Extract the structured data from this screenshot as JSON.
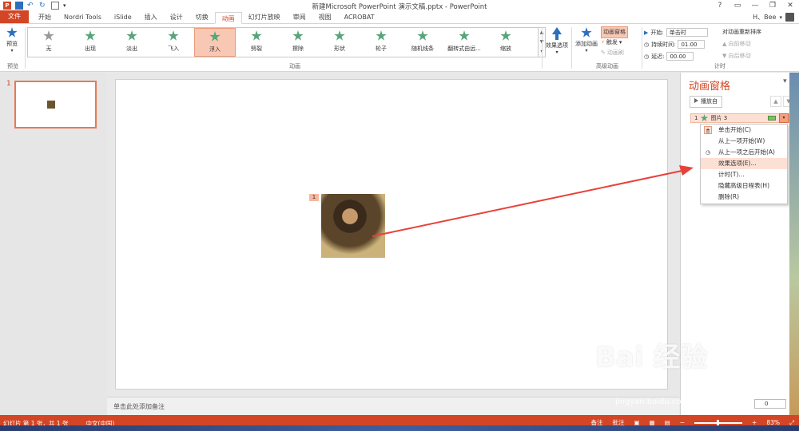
{
  "window": {
    "title": "新建Microsoft PowerPoint 演示文稿.pptx - PowerPoint",
    "controls": [
      "?",
      "▭",
      "—",
      "❐",
      "✕"
    ],
    "user": "H、Bee"
  },
  "tabs": [
    {
      "label": "文件"
    },
    {
      "label": "开始"
    },
    {
      "label": "Nordri Tools"
    },
    {
      "label": "iSlide"
    },
    {
      "label": "插入"
    },
    {
      "label": "设计"
    },
    {
      "label": "切换"
    },
    {
      "label": "动画"
    },
    {
      "label": "幻灯片放映"
    },
    {
      "label": "审阅"
    },
    {
      "label": "视图"
    },
    {
      "label": "ACROBAT"
    }
  ],
  "active_tab": "动画",
  "ribbon": {
    "preview_label": "预览",
    "preview_group": "预览",
    "animation_group": "动画",
    "animations": [
      {
        "label": "无",
        "icon": "star-icon"
      },
      {
        "label": "出现",
        "icon": "star-burst-icon"
      },
      {
        "label": "淡出",
        "icon": "star-icon"
      },
      {
        "label": "飞入",
        "icon": "star-icon"
      },
      {
        "label": "浮入",
        "icon": "star-icon"
      },
      {
        "label": "劈裂",
        "icon": "star-icon"
      },
      {
        "label": "擦除",
        "icon": "star-icon"
      },
      {
        "label": "形状",
        "icon": "star-icon"
      },
      {
        "label": "轮子",
        "icon": "star-icon"
      },
      {
        "label": "随机线条",
        "icon": "star-icon"
      },
      {
        "label": "翻转式由远...",
        "icon": "star-icon"
      },
      {
        "label": "缩放",
        "icon": "star-icon"
      }
    ],
    "selected_animation": "浮入",
    "effect_options": "效果选项",
    "add_animation": "添加动画",
    "advanced_group": "高级动画",
    "animation_pane_btn": "动画窗格",
    "trigger": "触发",
    "animation_painter": "动画刷",
    "timing_group": "计时",
    "start_label": "开始:",
    "start_value": "单击时",
    "duration_label": "持续时间:",
    "duration_value": "01.00",
    "delay_label": "延迟:",
    "delay_value": "00.00",
    "reorder_label": "对动画重新排序",
    "move_earlier": "向前移动",
    "move_later": "向后移动"
  },
  "slides_pane": {
    "slide_number": "1"
  },
  "canvas": {
    "animation_badge": "1",
    "notes_placeholder": "单击此处添加备注"
  },
  "animation_pane": {
    "title": "动画窗格",
    "play_button": "播放自",
    "item": {
      "order": "1",
      "name": "图片 3"
    },
    "menu": [
      {
        "label": "单击开始(C)",
        "icon": "mouse-icon"
      },
      {
        "label": "从上一项开始(W)",
        "icon": ""
      },
      {
        "label": "从上一项之后开始(A)",
        "icon": "clock-icon"
      },
      {
        "label": "效果选项(E)...",
        "icon": ""
      },
      {
        "label": "计时(T)...",
        "icon": ""
      },
      {
        "label": "隐藏高级日程表(H)",
        "icon": ""
      },
      {
        "label": "删除(R)",
        "icon": ""
      }
    ],
    "highlighted_menu_item": "效果选项(E)..."
  },
  "status": {
    "slide_info": "幻灯片 第 1 张，共 1 张",
    "language": "中文(中国)",
    "notes": "备注",
    "comments": "批注",
    "zoom": "83%",
    "slide_counter": "0"
  },
  "watermark": {
    "text": "Bai 经验",
    "url": "jingyan.baidu.com"
  },
  "colors": {
    "accent": "#d24625",
    "selection": "#f9c8b4",
    "star_green": "#58a57a",
    "arrow_red": "#e8413a"
  }
}
